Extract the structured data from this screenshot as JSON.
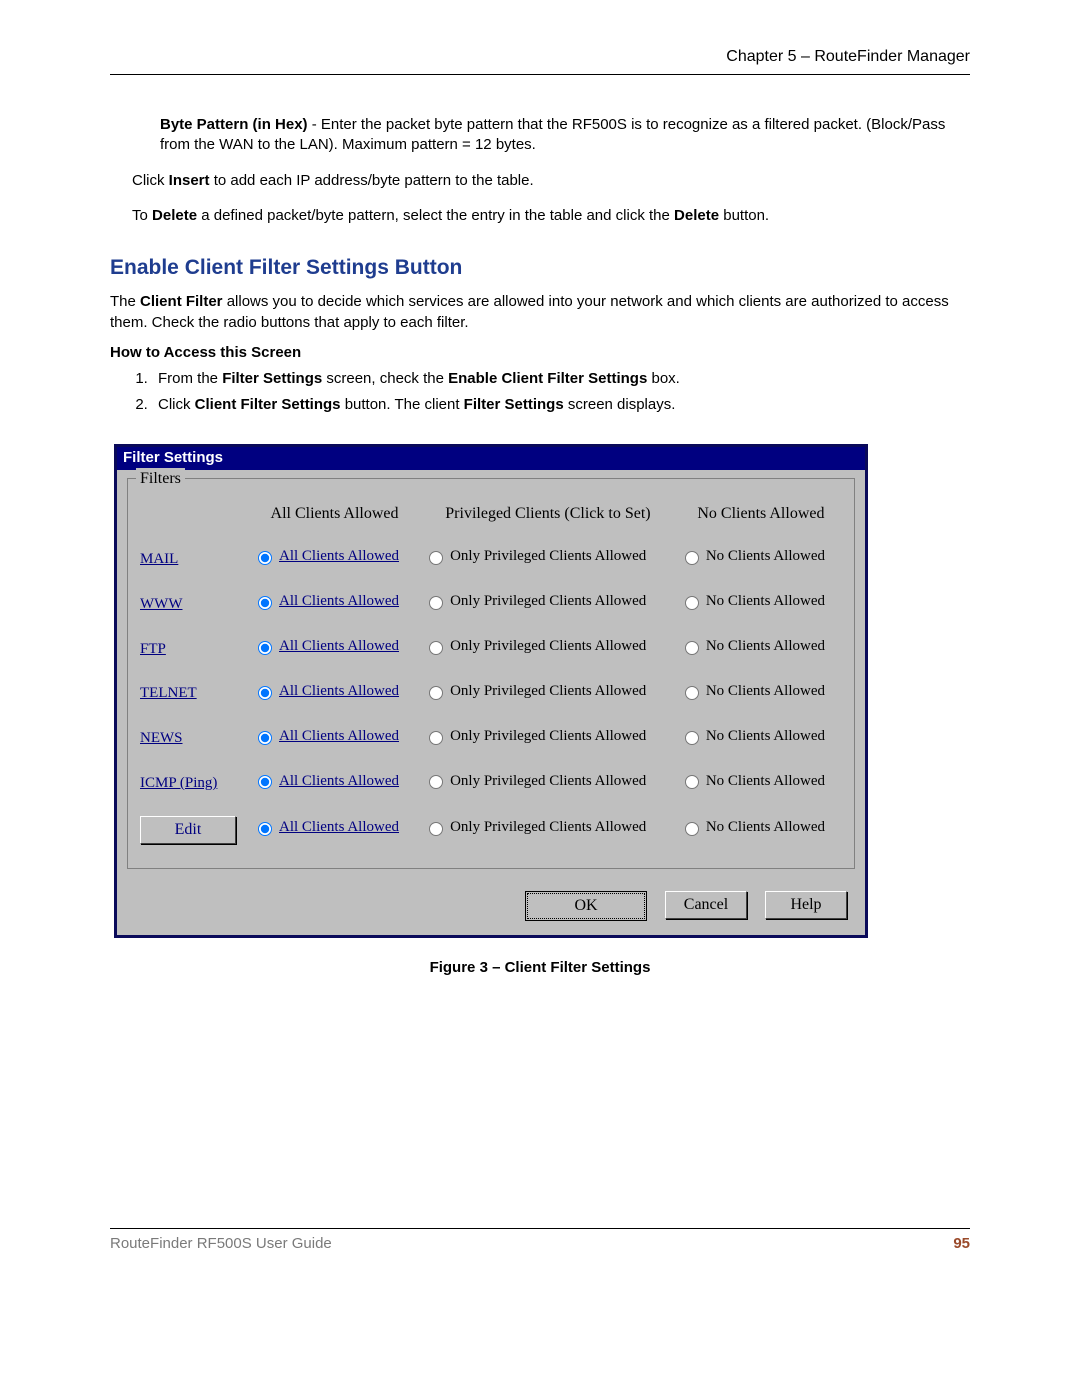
{
  "header": {
    "chapter": "Chapter 5 – RouteFinder Manager"
  },
  "intro": {
    "byte_label": "Byte Pattern (in Hex)",
    "byte_text": " - Enter the packet byte pattern that the RF500S is to recognize as a filtered packet. (Block/Pass from the WAN to the LAN). Maximum pattern = 12 bytes.",
    "insert1": "Click ",
    "insert_b": "Insert",
    "insert2": " to add each IP address/byte pattern to the table.",
    "del1": "To ",
    "del_b1": "Delete",
    "del2": " a defined packet/byte pattern, select the entry in the table and click ",
    "del_the": "the ",
    "del_b2": "Delete",
    "del3": " button."
  },
  "section_heading": "Enable Client Filter Settings Button",
  "client_filter_para": {
    "p1": "The ",
    "p_b": "Client Filter",
    "p2": " allows you to decide which services are allowed into your network and which clients are authorized to access them. Check the radio buttons that apply to each filter."
  },
  "howto_heading": "How to Access this Screen",
  "steps": {
    "s1a": "From the ",
    "s1b": "Filter Settings",
    "s1c": " screen, check the ",
    "s1d": "Enable Client Filter Settings",
    "s1e": " box.",
    "s2a": "Click ",
    "s2b": "Client Filter Settings",
    "s2c": " button. The client ",
    "s2d": "Filter Settings",
    "s2e": " screen displays."
  },
  "dialog": {
    "title": "Filter Settings",
    "group_legend": "Filters",
    "col1": "All Clients Allowed",
    "col2": "Privileged Clients (Click to Set)",
    "col3": "No Clients Allowed",
    "opt_all": "All Clients Allowed",
    "opt_priv": "Only Privileged Clients Allowed",
    "opt_none": "No Clients Allowed",
    "services": [
      "MAIL",
      "WWW",
      "FTP",
      "TELNET",
      "NEWS",
      "ICMP (Ping)"
    ],
    "edit_btn": "Edit",
    "ok": "OK",
    "cancel": "Cancel",
    "help": "Help"
  },
  "figure_caption": "Figure 3 – Client Filter Settings",
  "footer": {
    "left": "RouteFinder RF500S User Guide",
    "page": "95"
  }
}
